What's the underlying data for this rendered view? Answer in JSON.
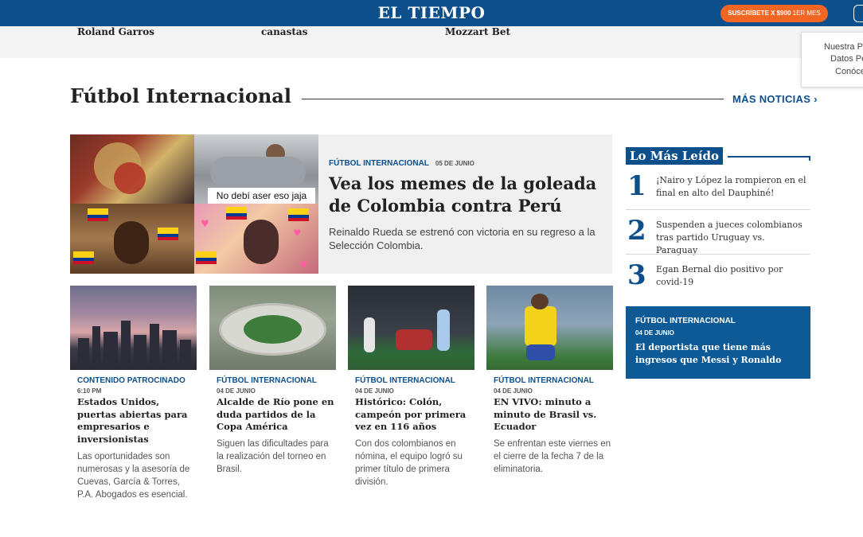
{
  "header": {
    "logo": "EL TIEMPO",
    "subscribe_label": "SUSCRÍBETE X $900",
    "subscribe_suffix": "1ER MES"
  },
  "strip": {
    "items": [
      "Roland Garros",
      "canastas",
      "Mozzart Bet"
    ]
  },
  "privacy": {
    "line1": "Nuestra P",
    "line2": "Datos Pe",
    "line3": "Conóce"
  },
  "section": {
    "title": "Fútbol Internacional",
    "more_label": "MÁS NOTICIAS ›"
  },
  "feature": {
    "tag": "FÚTBOL INTERNACIONAL",
    "date": "05 DE JUNIO",
    "headline": "Vea los memes de la goleada de Colombia contra Perú",
    "summary": "Reinaldo Rueda se estrenó con victoria en su regreso a la Selección Colombia.",
    "meme_caption": "No debí aser eso jaja"
  },
  "cards": [
    {
      "tag": "CONTENIDO PATROCINADO",
      "date": "6:10 PM",
      "title": "Estados Unidos, puertas abiertas para empresarios e inversionistas",
      "text": "Las oportunidades son numerosas y la asesoría de Cuevas, García & Torres, P.A. Abogados es esencial."
    },
    {
      "tag": "FÚTBOL INTERNACIONAL",
      "date": "04 DE JUNIO",
      "title": "Alcalde de Río pone en duda partidos de la Copa América",
      "text": "Siguen las dificultades para la realización del torneo en Brasil."
    },
    {
      "tag": "FÚTBOL INTERNACIONAL",
      "date": "04 DE JUNIO",
      "title": "Histórico: Colón, campeón por primera vez en 116 años",
      "text": "Con dos colombianos en nómina, el equipo logró su primer título de primera división."
    },
    {
      "tag": "FÚTBOL INTERNACIONAL",
      "date": "04 DE JUNIO",
      "title": "EN VIVO: minuto a minuto de Brasil vs. Ecuador",
      "text": "Se enfrentan este viernes en el cierre de la fecha 7 de la eliminatoria."
    }
  ],
  "most_read": {
    "title": "Lo Más Leído",
    "items": [
      {
        "num": "1",
        "text": "¡Nairo y López la rompieron en el final en alto del Dauphiné!"
      },
      {
        "num": "2",
        "text": "Suspenden a jueces colombianos tras partido Uruguay vs. Paraguay"
      },
      {
        "num": "3",
        "text": "Egan Bernal dio positivo por covid-19"
      }
    ]
  },
  "promo": {
    "tag": "FÚTBOL INTERNACIONAL",
    "date": "04 DE JUNIO",
    "title": "El deportista que tiene más ingresos que Messi y Ronaldo"
  },
  "icons": {
    "chevron": "chevron-right-icon",
    "user": "user-icon"
  },
  "colors": {
    "brand": "#0d4f8b",
    "subscribe": "#f26522",
    "promo_bg": "#0d5a96"
  }
}
